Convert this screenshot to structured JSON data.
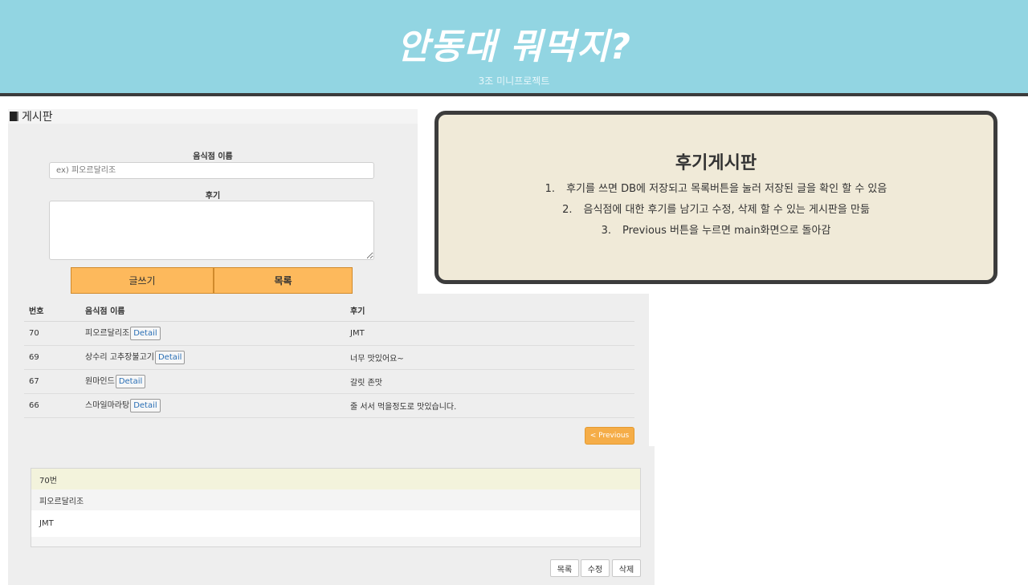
{
  "header": {
    "title": "안동대 뭐먹지?",
    "subtitle": "3조 미니프로젝트"
  },
  "board": {
    "label": "게시판"
  },
  "form": {
    "name_label": "음식점 이름",
    "name_placeholder": "ex) 피오르달리조",
    "review_label": "후기",
    "write_button": "글쓰기",
    "list_button": "목록"
  },
  "table": {
    "headers": [
      "번호",
      "음식점 이름",
      "후기"
    ],
    "detail_label": "Detail",
    "rows": [
      {
        "num": "70",
        "name": "피오르달리조",
        "review": "JMT"
      },
      {
        "num": "69",
        "name": "상수리 고추장불고기",
        "review": "너무 맛있어요~"
      },
      {
        "num": "67",
        "name": "원마인드",
        "review": "갈릿 존맛"
      },
      {
        "num": "66",
        "name": "스마일마라탕",
        "review": "줄 서서 먹을정도로 맛있습니다."
      }
    ],
    "prev_button": "< Previous"
  },
  "detail": {
    "number": "70번",
    "name": "피오르달리조",
    "review": "JMT",
    "buttons": {
      "list": "목록",
      "edit": "수정",
      "delete": "삭제"
    }
  },
  "info": {
    "title": "후기게시판",
    "items": [
      {
        "num": "1.",
        "text": "후기를 쓰면 DB에 저장되고 목록버튼을 눌러 저장된 글을 확인 할 수 있음"
      },
      {
        "num": "2.",
        "text": "음식점에 대한 후기를 남기고 수정, 삭제 할 수 있는 게시판을 만듦"
      },
      {
        "num": "3.",
        "text": "Previous 버튼을 누르면 main화면으로 돌아감"
      }
    ]
  },
  "colors": {
    "header_bg": "#92d5e2",
    "button_orange": "#fdb95c",
    "info_bg": "#f0ead8"
  }
}
